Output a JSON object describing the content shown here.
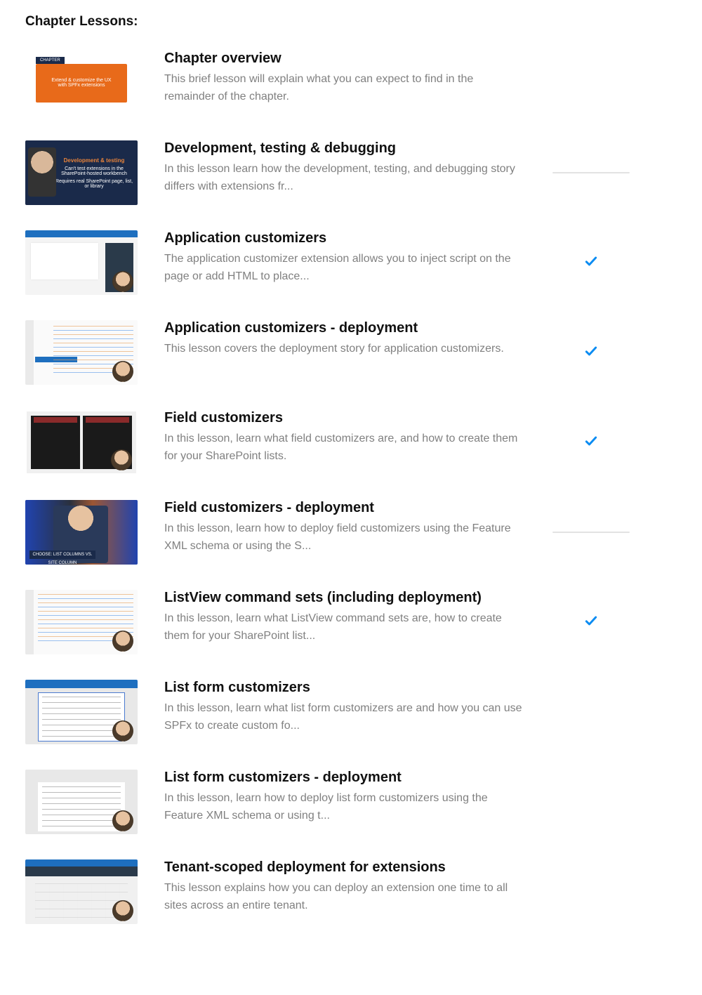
{
  "section_title": "Chapter Lessons:",
  "lessons": [
    {
      "title": "Chapter overview",
      "desc": "This brief lesson will explain what you can expect to find in the remainder of the chapter.",
      "status": "none",
      "thumb": {
        "type": "orange",
        "tag": "CHAPTER",
        "line1": "Extend & customize the UX",
        "line2": "with SPFx extensions"
      }
    },
    {
      "title": "Development, testing & debugging",
      "desc": "In this lesson learn how the development, testing, and debugging story differs with extensions fr...",
      "status": "progress",
      "thumb": {
        "type": "slide-dark",
        "heading": "Development & testing",
        "line1": "Can't test extensions in the SharePoint-hosted workbench",
        "line2": "Requires real SharePoint page, list, or library"
      }
    },
    {
      "title": "Application customizers",
      "desc": "The application customizer extension allows you to inject script on the page or add HTML to place...",
      "status": "check"
    },
    {
      "title": "Application customizers - deployment",
      "desc": "This lesson covers the deployment story for application customizers.",
      "status": "check"
    },
    {
      "title": "Field customizers",
      "desc": "In this lesson, learn what field customizers are, and how to create them for your SharePoint lists.",
      "status": "check"
    },
    {
      "title": "Field customizers - deployment",
      "desc": "In this lesson, learn how to deploy field customizers using the Feature XML schema or using the S...",
      "status": "progress",
      "thumb": {
        "label": "CHOOSE: LIST COLUMNS VS. SITE COLUMN"
      }
    },
    {
      "title": "ListView command sets (including deployment)",
      "desc": "In this lesson, learn what ListView command sets are, how to create them for your SharePoint list...",
      "status": "check"
    },
    {
      "title": "List form customizers",
      "desc": "In this lesson, learn what list form customizers are and how you can use SPFx to create custom fo...",
      "status": "none"
    },
    {
      "title": "List form customizers - deployment",
      "desc": "In this lesson, learn how to deploy list form customizers using the Feature XML schema or using t...",
      "status": "none"
    },
    {
      "title": "Tenant-scoped deployment for extensions",
      "desc": "This lesson explains how you can deploy an extension one time to all sites across an entire tenant.",
      "status": "none"
    }
  ]
}
